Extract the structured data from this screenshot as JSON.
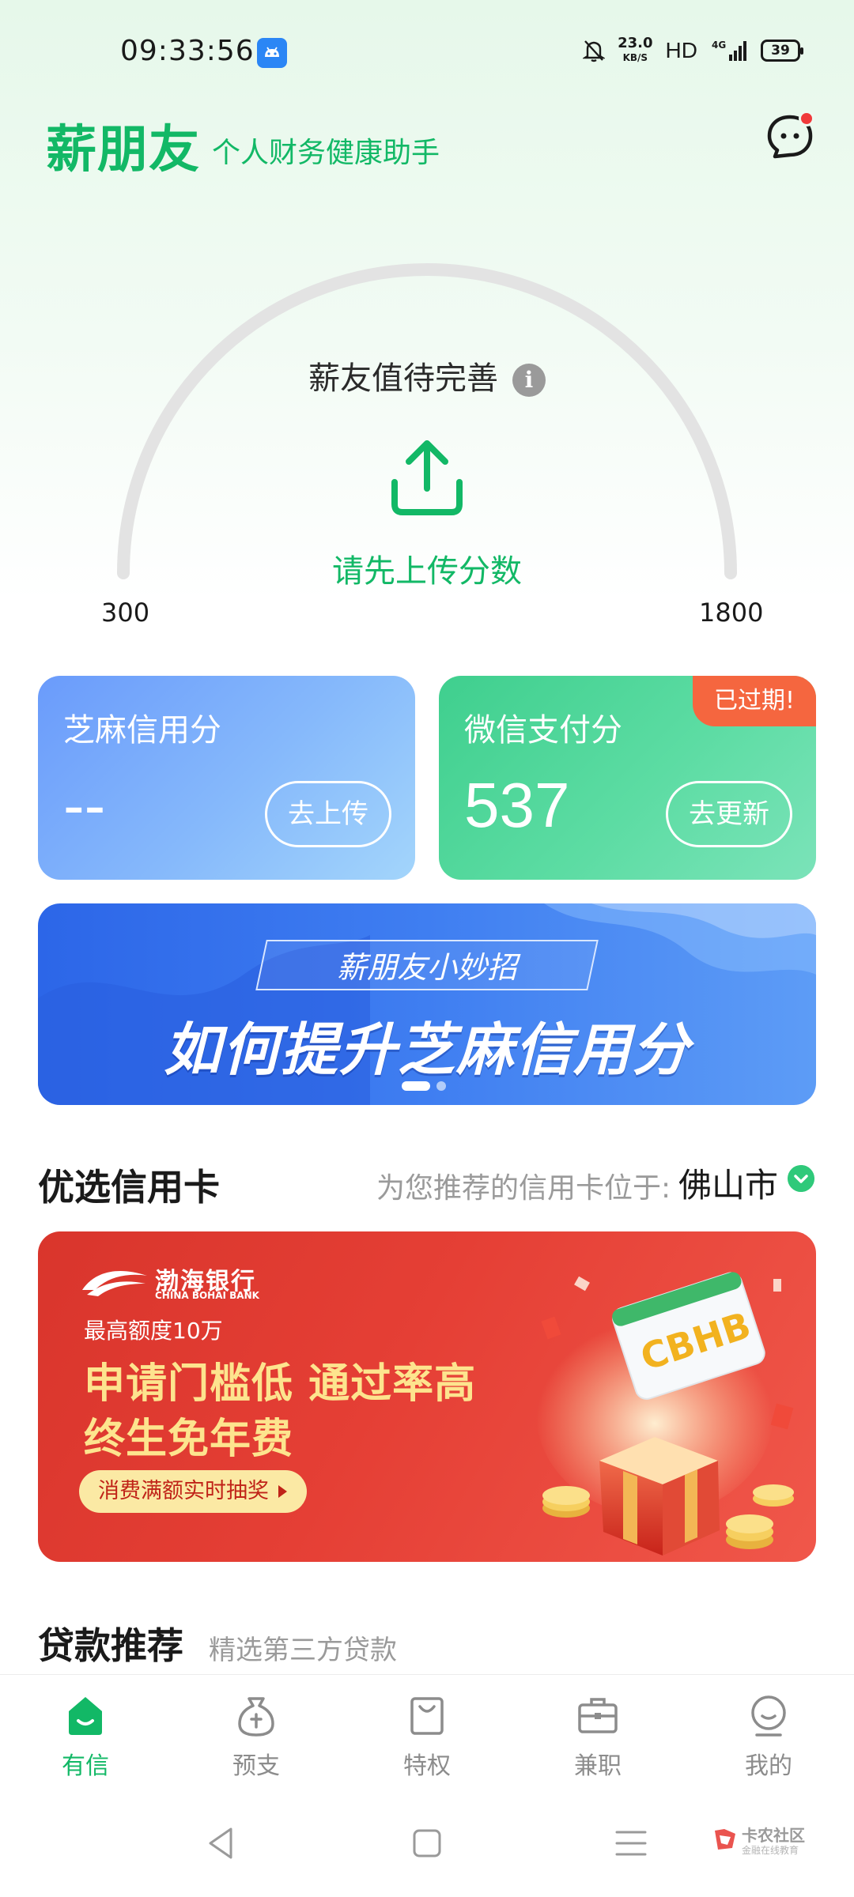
{
  "status_bar": {
    "time": "09:33:56",
    "speed_value": "23.0",
    "speed_unit": "KB/S",
    "hd": "HD",
    "network": "4G",
    "battery": "39",
    "icons": [
      "android-app-icon",
      "mute-bell-icon",
      "signal-icon",
      "battery-icon"
    ]
  },
  "header": {
    "title": "薪朋友",
    "subtitle": "个人财务健康助手",
    "message_icon": "chat-bubble-icon",
    "accent_color": "#12b866"
  },
  "gauge": {
    "title": "薪友值待完善",
    "info_icon": "i",
    "upload_text": "请先上传分数",
    "min": "300",
    "max": "1800"
  },
  "score_cards": {
    "zhima": {
      "label": "芝麻信用分",
      "value": "--",
      "button": "去上传"
    },
    "wechat": {
      "label": "微信支付分",
      "value": "537",
      "button": "去更新",
      "badge": "已过期!"
    }
  },
  "banner": {
    "tag": "薪朋友小妙招",
    "title": "如何提升芝麻信用分",
    "active_index": 0,
    "slides": 2
  },
  "credit_cards": {
    "section_title": "优选信用卡",
    "location_hint": "为您推荐的信用卡位于:",
    "city": "佛山市",
    "ad": {
      "bank_cn": "渤海银行",
      "bank_en": "CHINA BOHAI BANK",
      "limit": "最高额度10万",
      "line1": "申请门槛低 通过率高",
      "line2": "终生免年费",
      "cta": "消费满额实时抽奖",
      "card_text": "CBHB"
    }
  },
  "loans": {
    "section_title": "贷款推荐",
    "subtitle": "精选第三方贷款"
  },
  "bottom_nav": {
    "items": [
      {
        "label": "有信",
        "icon": "home-smile-icon",
        "active": true
      },
      {
        "label": "预支",
        "icon": "money-bag-icon",
        "active": false
      },
      {
        "label": "特权",
        "icon": "shopping-bag-icon",
        "active": false
      },
      {
        "label": "兼职",
        "icon": "briefcase-icon",
        "active": false
      },
      {
        "label": "我的",
        "icon": "profile-icon",
        "active": false
      }
    ]
  },
  "watermark": {
    "name": "卡农社区",
    "sub": "金融在线教育"
  }
}
